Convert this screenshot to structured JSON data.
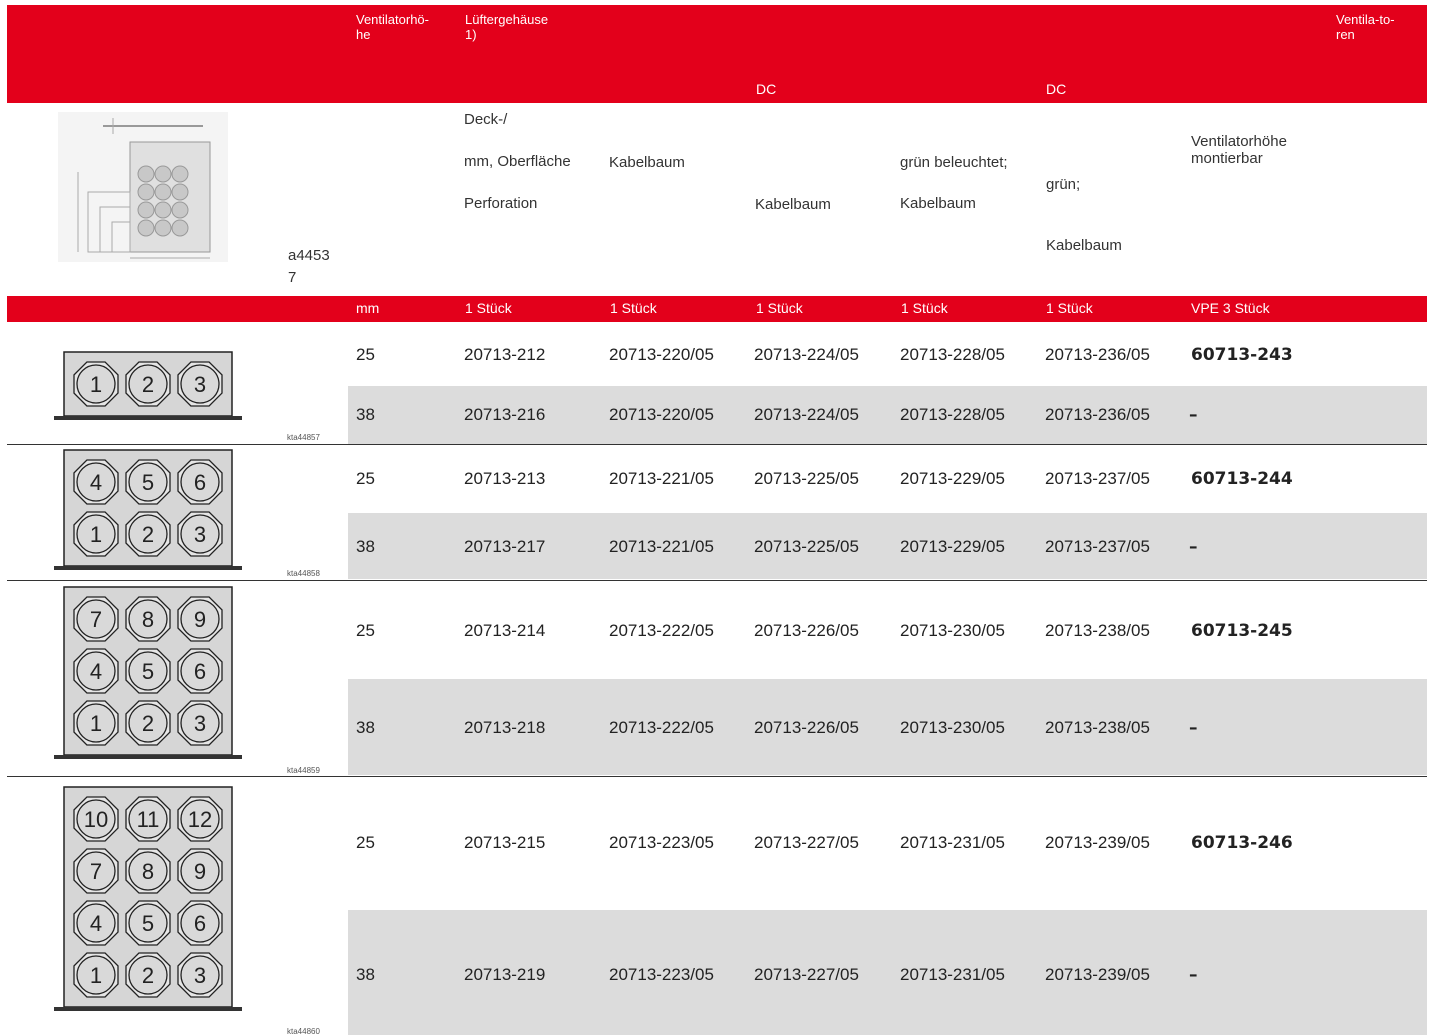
{
  "header": {
    "col_height": "Ventilatorhö-he",
    "col_housing": "Lüftergehäuse 1)",
    "col_fans": "Ventila-to-ren",
    "dc_label_1": "DC",
    "dc_label_2": "DC"
  },
  "descriptions": {
    "drawing_code": "a4453\n7",
    "housing": [
      "Deck-/",
      "mm, Oberfläche",
      "Perforation"
    ],
    "harness_1": "Kabelbaum",
    "harness_2": "Kabelbaum",
    "harness_3": [
      "grün beleuchtet;",
      "Kabelbaum"
    ],
    "harness_4": [
      "grün;",
      "Kabelbaum"
    ],
    "fans": [
      "Ventilatorhöhe",
      "montierbar"
    ]
  },
  "units": [
    "mm",
    "1 Stück",
    "1 Stück",
    "1 Stück",
    "1 Stück",
    "1 Stück",
    "VPE 3 Stück"
  ],
  "groups": [
    {
      "image_code": "kta44857",
      "rows": [
        {
          "height": "25",
          "housing": "20713-212",
          "h1": "20713-220/05",
          "h2": "20713-224/05",
          "h3": "20713-228/05",
          "h4": "20713-236/05",
          "fans": "60713-243"
        },
        {
          "height": "38",
          "housing": "20713-216",
          "h1": "20713-220/05",
          "h2": "20713-224/05",
          "h3": "20713-228/05",
          "h4": "20713-236/05",
          "fans": "–"
        }
      ]
    },
    {
      "image_code": "kta44858",
      "rows": [
        {
          "height": "25",
          "housing": "20713-213",
          "h1": "20713-221/05",
          "h2": "20713-225/05",
          "h3": "20713-229/05",
          "h4": "20713-237/05",
          "fans": "60713-244"
        },
        {
          "height": "38",
          "housing": "20713-217",
          "h1": "20713-221/05",
          "h2": "20713-225/05",
          "h3": "20713-229/05",
          "h4": "20713-237/05",
          "fans": "–"
        }
      ]
    },
    {
      "image_code": "kta44859",
      "rows": [
        {
          "height": "25",
          "housing": "20713-214",
          "h1": "20713-222/05",
          "h2": "20713-226/05",
          "h3": "20713-230/05",
          "h4": "20713-238/05",
          "fans": "60713-245"
        },
        {
          "height": "38",
          "housing": "20713-218",
          "h1": "20713-222/05",
          "h2": "20713-226/05",
          "h3": "20713-230/05",
          "h4": "20713-238/05",
          "fans": "–"
        }
      ]
    },
    {
      "image_code": "kta44860",
      "rows": [
        {
          "height": "25",
          "housing": "20713-215",
          "h1": "20713-223/05",
          "h2": "20713-227/05",
          "h3": "20713-231/05",
          "h4": "20713-239/05",
          "fans": "60713-246"
        },
        {
          "height": "38",
          "housing": "20713-219",
          "h1": "20713-223/05",
          "h2": "20713-227/05",
          "h3": "20713-231/05",
          "h4": "20713-239/05",
          "fans": "–"
        }
      ]
    }
  ],
  "fan_labels": [
    "1",
    "2",
    "3",
    "4",
    "5",
    "6",
    "7",
    "8",
    "9",
    "10",
    "11",
    "12"
  ],
  "colors": {
    "accent": "#e3001b",
    "row_shade": "#dcdcdc"
  }
}
